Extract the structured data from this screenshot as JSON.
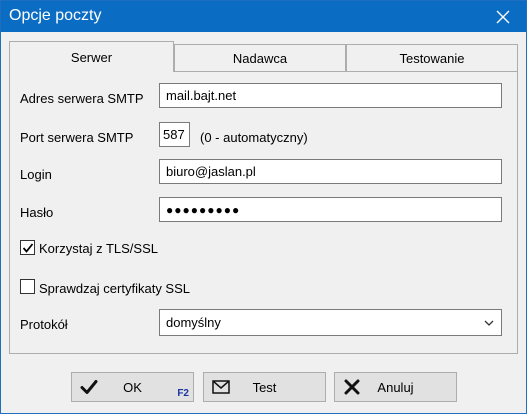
{
  "window": {
    "title": "Opcje poczty"
  },
  "tabs": [
    {
      "label": "Serwer",
      "active": true
    },
    {
      "label": "Nadawca",
      "active": false
    },
    {
      "label": "Testowanie",
      "active": false
    }
  ],
  "server": {
    "smtp_label": "Adres serwera SMTP",
    "smtp_value": "mail.bajt.net",
    "port_label": "Port serwera SMTP",
    "port_value": "587",
    "port_hint": "(0 - automatyczny)",
    "login_label": "Login",
    "login_value": "biuro@jaslan.pl",
    "password_label": "Hasło",
    "password_value": "●●●●●●●●●",
    "tls_label": "Korzystaj z TLS/SSL",
    "tls_checked": true,
    "cert_label": "Sprawdzaj certyfikaty SSL",
    "cert_checked": false,
    "protocol_label": "Protokół",
    "protocol_value": "domyślny"
  },
  "buttons": {
    "ok_label": "OK",
    "ok_hotkey": "F2",
    "test_label": "Test",
    "cancel_label": "Anuluj"
  },
  "icons": {
    "close": "close-icon",
    "ok": "check-icon",
    "test": "envelope-icon",
    "cancel": "x-icon",
    "dropdown": "chevron-down-icon"
  }
}
